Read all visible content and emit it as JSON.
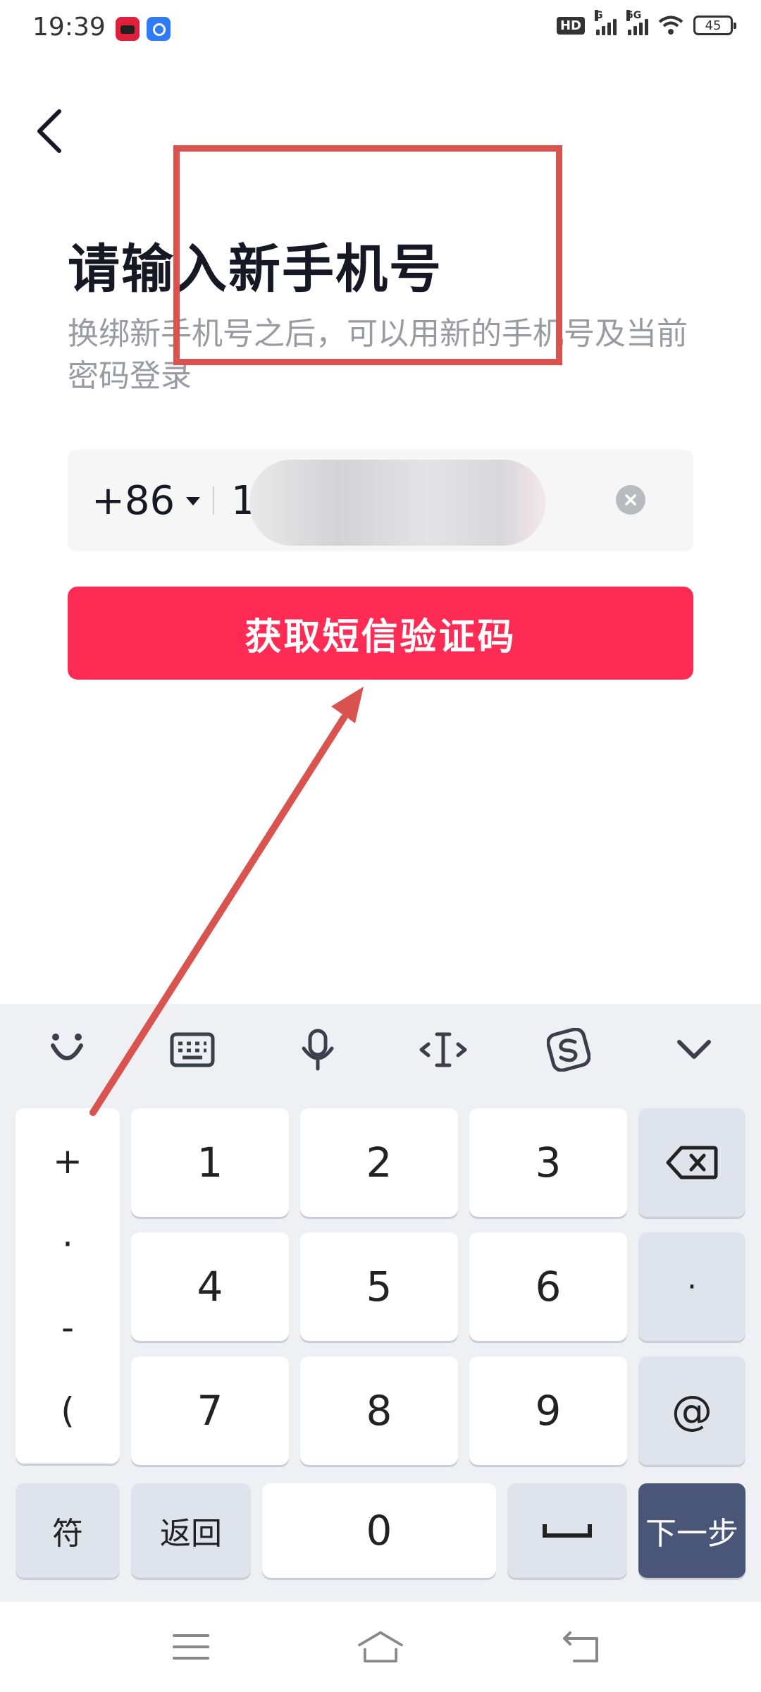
{
  "status_bar": {
    "time": "19:39",
    "network_badge": "HD",
    "signal_1_label": "G",
    "signal_2_label": "5G",
    "battery": "45"
  },
  "header": {
    "title": "请输入新手机号",
    "subtitle": "换绑新手机号之后，可以用新的手机号及当前密码登录"
  },
  "phone_input": {
    "country_code": "+86",
    "value_visible_prefix": "1"
  },
  "actions": {
    "sms_button_label": "获取短信验证码"
  },
  "keyboard": {
    "toolbar_icons": [
      "emoji-icon",
      "keyboard-icon",
      "microphone-icon",
      "cursor-icon",
      "sogou-icon",
      "collapse-icon"
    ],
    "symbols": [
      "+",
      "·",
      "-",
      "("
    ],
    "digits": [
      "1",
      "2",
      "3",
      "4",
      "5",
      "6",
      "7",
      "8",
      "9"
    ],
    "right_keys": [
      "·",
      "@"
    ],
    "bottom": {
      "symbols_label": "符",
      "back_label": "返回",
      "zero_label": "0",
      "next_label": "下一步"
    }
  },
  "colors": {
    "accent": "#fe2c55",
    "annotation": "#d9534f",
    "next_key": "#4a5677"
  }
}
